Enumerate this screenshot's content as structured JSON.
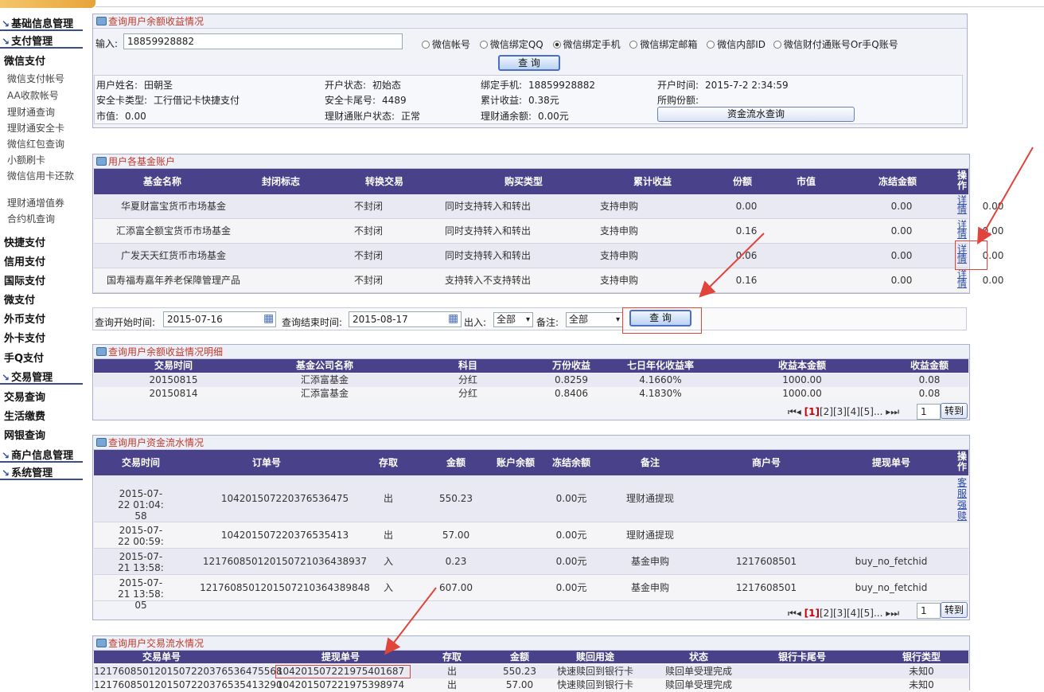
{
  "sidebar": {
    "heads": [
      "基础信息管理",
      "支付管理",
      "交易管理",
      "商户信息管理",
      "系统管理"
    ],
    "weixin_pay": "微信支付",
    "weixin_items": [
      "微信支付帐号",
      "AA收款帐号",
      "理财通查询",
      "理财通安全卡",
      "微信红包查询",
      "小额刷卡",
      "微信信用卡还款",
      "理财通增值券",
      "合约机查询"
    ],
    "pay_items": [
      "快捷支付",
      "信用支付",
      "国际支付",
      "微支付",
      "外币支付",
      "外卡支付",
      "手Q支付"
    ],
    "trade_items": [
      "交易查询",
      "生活缴费",
      "网银查询"
    ]
  },
  "panel1": {
    "title": "查询用户余额收益情况",
    "input_label": "输入:",
    "input_value": "18859928882",
    "radios": [
      "微信帐号",
      "微信绑定QQ",
      "微信绑定手机",
      "微信绑定邮箱",
      "微信内部ID",
      "微信财付通账号Or手Q账号"
    ],
    "selected_radio": "微信绑定手机",
    "query_btn": "查 询",
    "info": [
      [
        "用户姓名:",
        "田朝圣",
        "开户状态:",
        "初始态",
        "绑定手机:",
        "18859928882",
        "开户时间:",
        "2015-7-2 2:34:59"
      ],
      [
        "安全卡类型:",
        "工行借记卡快捷支付",
        "安全卡尾号:",
        "4489",
        "累计收益:",
        "0.38元",
        "所购份额:",
        ""
      ],
      [
        "市值:",
        "0.00",
        "理财通账户状态:",
        "正常",
        "理财通余额:",
        "0.00元",
        "",
        ""
      ]
    ],
    "flow_btn": "资金流水查询"
  },
  "panel2": {
    "title": "用户各基金账户",
    "headers": [
      "基金名称",
      "封闭标志",
      "转换交易",
      "购买类型",
      "累计收益",
      "份额",
      "市值",
      "冻结金额",
      "操作"
    ],
    "rows": [
      [
        "华夏财富宝货币市场基金",
        "不封闭",
        "同时支持转入和转出",
        "支持申购",
        "0.00",
        "",
        "0.00",
        "0.00",
        "详情"
      ],
      [
        "汇添富全额宝货币市场基金",
        "不封闭",
        "同时支持转入和转出",
        "支持申购",
        "0.16",
        "",
        "0.00",
        "0.00",
        "详情"
      ],
      [
        "广发天天红货币市场基金",
        "不封闭",
        "同时支持转入和转出",
        "支持申购",
        "0.06",
        "",
        "0.00",
        "0.00",
        "详情"
      ],
      [
        "国寿福寿嘉年养老保障管理产品",
        "不封闭",
        "支持转入不支持转出",
        "支持申购",
        "0.16",
        "",
        "0.00",
        "0.00",
        "详情"
      ]
    ]
  },
  "search": {
    "start_label": "查询开始时间:",
    "start": "2015-07-16",
    "end_label": "查询结束时间:",
    "end": "2015-08-17",
    "inout_label": "出入:",
    "inout": "全部",
    "note_label": "备注:",
    "note": "全部",
    "query_btn": "查 询"
  },
  "panel3": {
    "title": "查询用户余额收益情况明细",
    "headers": [
      "交易时间",
      "基金公司名称",
      "科目",
      "万份收益",
      "七日年化收益率",
      "收益本金额",
      "收益金额"
    ],
    "rows": [
      [
        "20150815",
        "汇添富基金",
        "分红",
        "0.8259",
        "4.1660%",
        "1000.00",
        "0.08"
      ],
      [
        "20150814",
        "汇添富基金",
        "分红",
        "0.8406",
        "4.1830%",
        "1000.00",
        "0.08"
      ]
    ],
    "pager": {
      "current": "[1]",
      "pages": "[2][3][4][5]...",
      "goto_value": "1",
      "goto_btn": "转到"
    }
  },
  "panel4": {
    "title": "查询用户资金流水情况",
    "headers": [
      "交易时间",
      "订单号",
      "存取",
      "金额",
      "账户余额",
      "冻结余额",
      "备注",
      "商户号",
      "提现单号",
      "操作"
    ],
    "rows": [
      [
        "2015-07-22 01:04:58",
        "104201507220376536475",
        "出",
        "550.23",
        "",
        "0.00元",
        "理财通提现",
        "",
        "",
        "客服强赎"
      ],
      [
        "2015-07-22 00:59:17",
        "104201507220376535413",
        "出",
        "57.00",
        "",
        "0.00元",
        "理财通提现",
        "",
        "",
        ""
      ],
      [
        "2015-07-21 13:58:05",
        "121760850120150721036438937",
        "入",
        "0.23",
        "",
        "0.00元",
        "基金申购",
        "1217608501",
        "buy_no_fetchid",
        ""
      ],
      [
        "2015-07-21 13:58:05",
        "121760850120150721036438984​8",
        "入",
        "607.00",
        "",
        "0.00元",
        "基金申购",
        "1217608501",
        "buy_no_fetchid",
        ""
      ]
    ],
    "pager": {
      "current": "[1]",
      "pages": "[2][3][4][5]...",
      "goto_value": "1",
      "goto_btn": "转到"
    }
  },
  "panel5": {
    "title": "查询用户交易流水情况",
    "headers": [
      "交易单号",
      "提现单号",
      "存取",
      "金额",
      "赎回用途",
      "状态",
      "银行卡尾号",
      "银行类型"
    ],
    "rows": [
      [
        "121760850120150722037653647556​8",
        "104201507221975401687",
        "出",
        "550.23",
        "快速赎回到银行卡",
        "赎回单受理完成",
        "",
        "未知0"
      ],
      [
        "121760850120150722037653541329​0",
        "104201507221975398974",
        "出",
        "57.00",
        "快速赎回到银行卡",
        "赎回单受理完成",
        "",
        "未知0"
      ]
    ]
  }
}
